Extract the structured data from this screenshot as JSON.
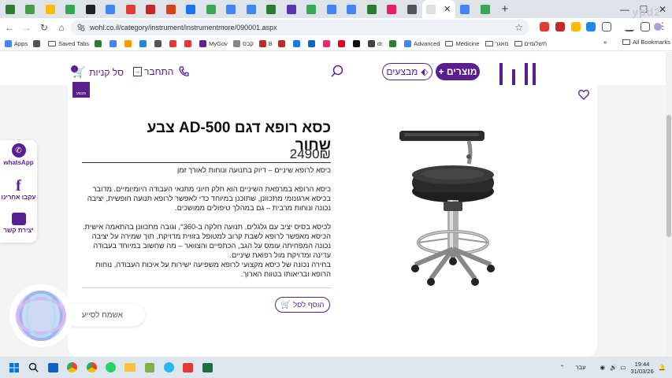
{
  "browser": {
    "tab_colors": [
      "#2e7d32",
      "#43a047",
      "#fbbc05",
      "#34a853",
      "#222222",
      "#4285f4",
      "#e53935",
      "#c62828",
      "#d84315",
      "#1877f2",
      "#34a853",
      "#4285f4",
      "#4285f4",
      "#2e7d32",
      "#5e35b1",
      "#34a853",
      "#4285f4",
      "#4285f4",
      "#2e7d32",
      "#e91e63",
      "#555555",
      "#4285f4",
      "#34a853"
    ],
    "url": "wohl.co.il/category/instrument/instrumentmore/090001.aspx",
    "ghost_text": "ypd2"
  },
  "bookmarks": [
    {
      "label": "Apps",
      "color": "#4285f4",
      "kind": "icon"
    },
    {
      "label": "",
      "color": "#555555",
      "kind": "icon"
    },
    {
      "label": "Saved Tabs",
      "color": "",
      "kind": "folder"
    },
    {
      "label": "",
      "color": "#2e7d32",
      "kind": "icon"
    },
    {
      "label": "",
      "color": "#4285f4",
      "kind": "icon"
    },
    {
      "label": "",
      "color": "#ff9800",
      "kind": "icon"
    },
    {
      "label": "",
      "color": "#1e88e5",
      "kind": "icon"
    },
    {
      "label": "",
      "color": "#555555",
      "kind": "icon"
    },
    {
      "label": "",
      "color": "#e53935",
      "kind": "icon"
    },
    {
      "label": "",
      "color": "#e53935",
      "kind": "icon"
    },
    {
      "label": "MyGov",
      "color": "#6a1b9a",
      "kind": "icon"
    },
    {
      "label": "קבס",
      "color": "#888888",
      "kind": "icon"
    },
    {
      "label": "B",
      "color": "#c62828",
      "kind": "icon"
    },
    {
      "label": "",
      "color": "#c62828",
      "kind": "icon"
    },
    {
      "label": "",
      "color": "#1877f2",
      "kind": "icon"
    },
    {
      "label": "",
      "color": "#0a66c2",
      "kind": "icon"
    },
    {
      "label": "",
      "color": "#e1306c",
      "kind": "icon"
    },
    {
      "label": "",
      "color": "#e60023",
      "kind": "icon"
    },
    {
      "label": "",
      "color": "#111111",
      "kind": "icon"
    },
    {
      "label": "dr.",
      "color": "#444444",
      "kind": "icon"
    },
    {
      "label": "",
      "color": "#2e7d32",
      "kind": "icon"
    },
    {
      "label": "Advanced",
      "color": "#4285f4",
      "kind": "icon"
    },
    {
      "label": "Medicine",
      "color": "",
      "kind": "folder"
    },
    {
      "label": "מאגר",
      "color": "",
      "kind": "folder"
    },
    {
      "label": "תשלומים",
      "color": "",
      "kind": "folder"
    }
  ],
  "bookmarks_more": "»",
  "all_bookmarks": "All Bookmarks",
  "site": {
    "products_btn": "+ מוצרים",
    "deals_btn": "מבצעים",
    "login": "התחבר",
    "cart": "סל קניות",
    "sale_tag": "מבצע"
  },
  "product": {
    "title": "כסא רופא דגם AD-500 צבע שחור",
    "price": "2490₪",
    "desc": [
      "כיסא לרופא שיניים – דיוק בתנועה ונוחות לאורך זמן",
      "כיסא הרופא במרפאת השיניים הוא חלק חיוני מתנאי העבודה היומיומיים. מדובר בכיסא ארגונומי מתכוונן, שתוכנן במיוחד כדי לאפשר לרופא תנועה חופשית, יציבה נכונה ונוחות מרבית – גם במהלך טיפולים ממושכים.",
      "לכיסא בסיס יציב עם גלגלים, תנועה חלקה ב-°360, וגובה מתכוונן בהתאמה אישית. הכיסא מאפשר לרופא לשבת קרוב למטופל בזווית מדויקת, תוך שמירה על יציבה נכונה המפחיתה עומס על הגב, הכתפיים והצוואר – מה שחשוב במיוחד בעבודה עדינה ומדויקת מול רפואת שיניים.",
      "בחירה נכונה של כיסא מקצועי לרופא משפיעה ישירות על איכות העבודה, נוחות הרופא ובריאותו בטווח הארוך."
    ],
    "add_to_cart": "הוסף לסל"
  },
  "side": {
    "whatsapp": "whatsApp",
    "facebook": "עקבו אחרינו",
    "contact": "יצירת קשר"
  },
  "chat": {
    "label": "אשמח לסייע"
  },
  "taskbar": {
    "lang": "עבר",
    "time": "19:44",
    "date": "31/03/26"
  }
}
